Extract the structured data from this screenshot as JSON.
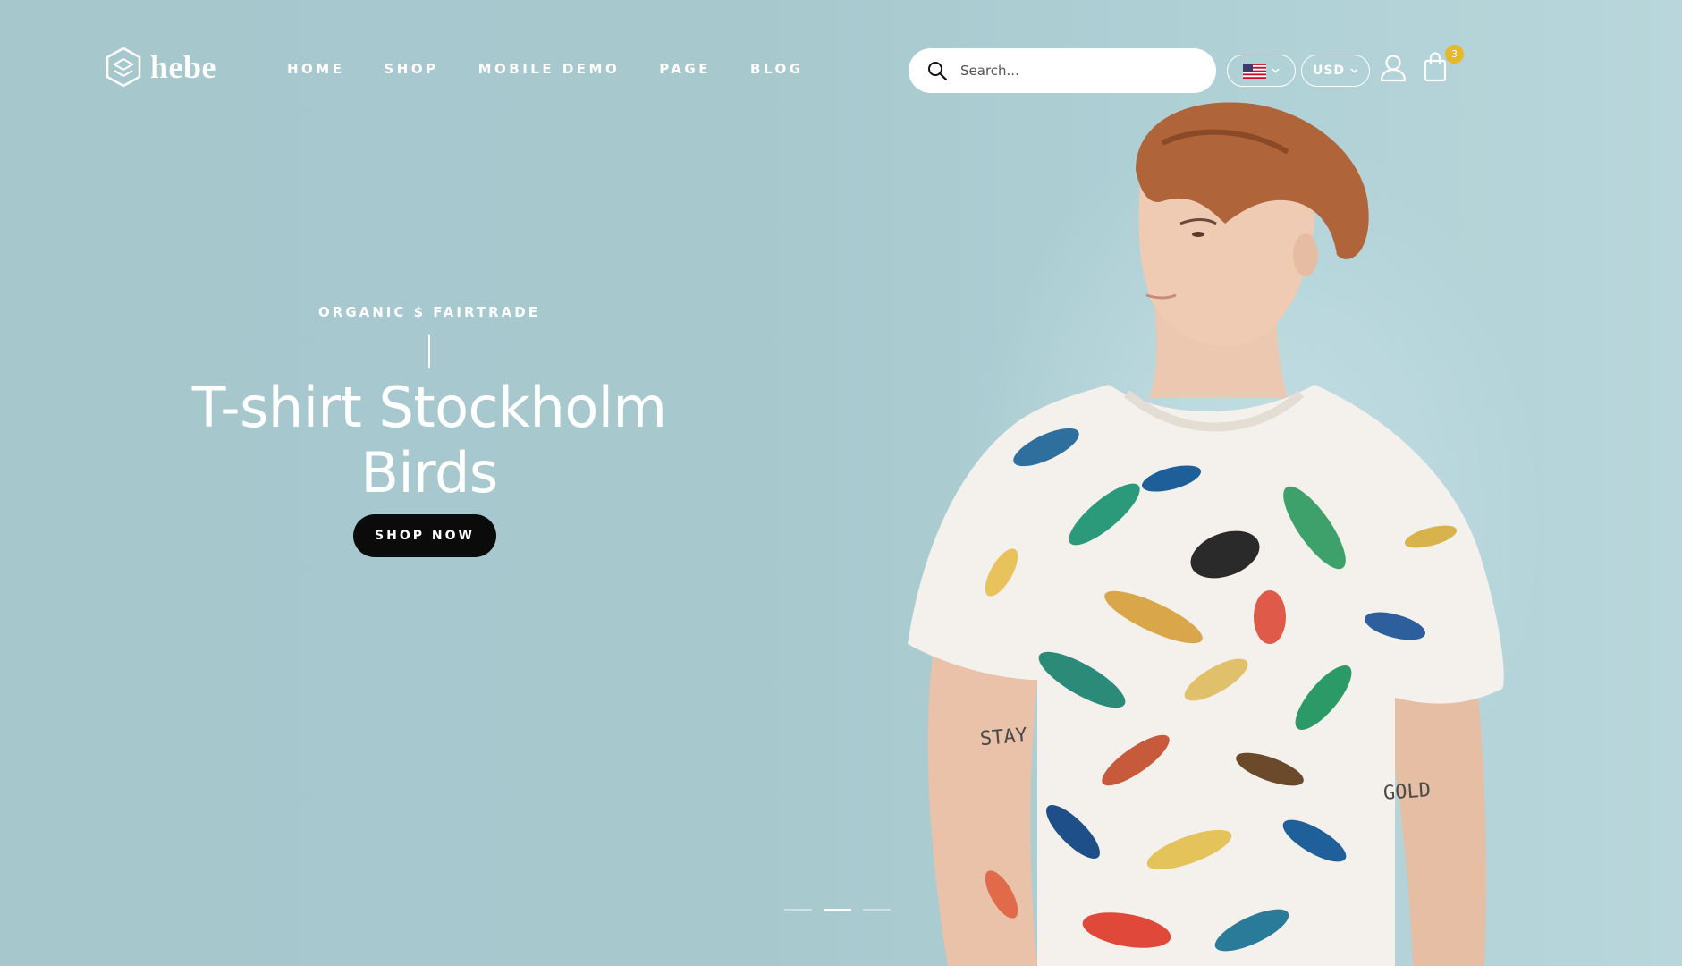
{
  "brand": {
    "name": "hebe"
  },
  "nav": {
    "items": [
      "HOME",
      "SHOP",
      "MOBILE DEMO",
      "PAGE",
      "BLOG"
    ]
  },
  "search": {
    "placeholder": "Search..."
  },
  "locale": {
    "language_flag": "us-flag-icon",
    "currency": "USD"
  },
  "cart": {
    "count": "3"
  },
  "hero": {
    "eyebrow": "ORGANIC $ FAIRTRADE",
    "title_line1": "T-shirt Stockholm",
    "title_line2": "Birds",
    "cta_label": "SHOP NOW",
    "tattoo_left": "STAY",
    "tattoo_right": "GOLD"
  },
  "slider": {
    "count": 3,
    "active_index": 1
  },
  "colors": {
    "background": "#a6c8cd",
    "text": "#ffffff",
    "cta_bg": "#0b0b0b",
    "badge": "#e6b82b"
  },
  "icons": [
    "logo-icon",
    "search-icon",
    "us-flag-icon",
    "chevron-down-icon",
    "user-icon",
    "shopping-bag-icon"
  ]
}
